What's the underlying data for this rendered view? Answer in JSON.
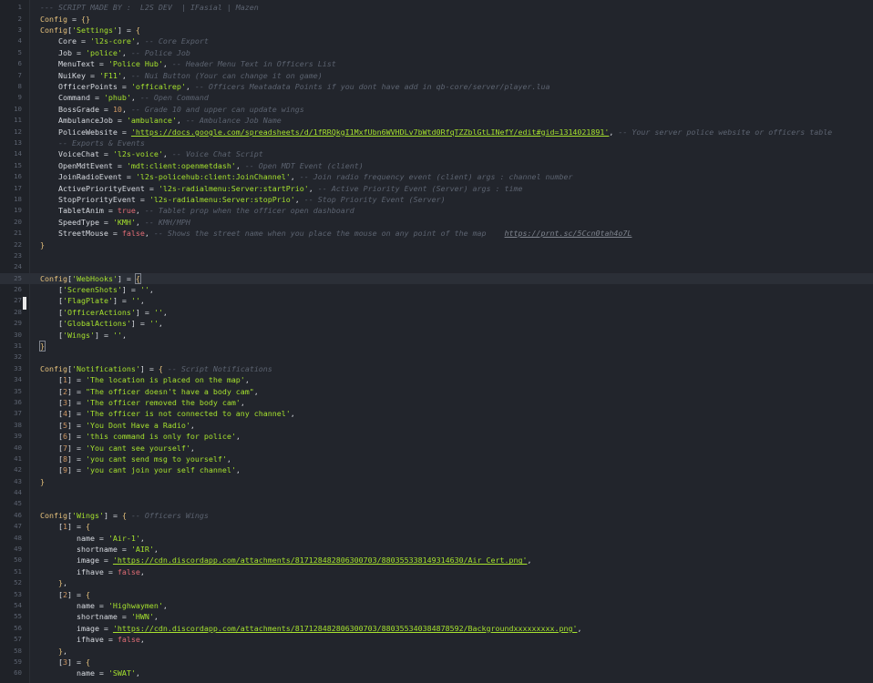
{
  "editor": {
    "active_line": 25,
    "lines": [
      {
        "n": "1",
        "tokens": [
          [
            "cmt",
            "--- SCRIPT MADE BY :  L2S DEV  | IFasial | Mazen"
          ]
        ]
      },
      {
        "n": "2",
        "tokens": [
          [
            "kw",
            "Config"
          ],
          [
            "plain",
            " = "
          ],
          [
            "brace",
            "{}"
          ]
        ]
      },
      {
        "n": "3",
        "tokens": [
          [
            "kw",
            "Config"
          ],
          [
            "plain",
            "["
          ],
          [
            "str",
            "'Settings'"
          ],
          [
            "plain",
            "] = "
          ],
          [
            "brace",
            "{"
          ]
        ]
      },
      {
        "n": "4",
        "tokens": [
          [
            "plain",
            "    Core = "
          ],
          [
            "str",
            "'l2s-core'"
          ],
          [
            "plain",
            ", "
          ],
          [
            "cmt",
            "-- Core Export"
          ]
        ]
      },
      {
        "n": "5",
        "tokens": [
          [
            "plain",
            "    Job = "
          ],
          [
            "str",
            "'police'"
          ],
          [
            "plain",
            ", "
          ],
          [
            "cmt",
            "-- Police Job"
          ]
        ]
      },
      {
        "n": "6",
        "tokens": [
          [
            "plain",
            "    MenuText = "
          ],
          [
            "str",
            "'Police Hub'"
          ],
          [
            "plain",
            ", "
          ],
          [
            "cmt",
            "-- Header Menu Text in Officers List"
          ]
        ]
      },
      {
        "n": "7",
        "tokens": [
          [
            "plain",
            "    NuiKey = "
          ],
          [
            "str",
            "'F11'"
          ],
          [
            "plain",
            ", "
          ],
          [
            "cmt",
            "-- Nui Button (Your can change it on game)"
          ]
        ]
      },
      {
        "n": "8",
        "tokens": [
          [
            "plain",
            "    OfficerPoints = "
          ],
          [
            "str",
            "'officalrep'"
          ],
          [
            "plain",
            ", "
          ],
          [
            "cmt",
            "-- Officers Meatadata Points if you dont have add in qb-core/server/player.lua"
          ]
        ]
      },
      {
        "n": "9",
        "tokens": [
          [
            "plain",
            "    Command = "
          ],
          [
            "str",
            "'phub'"
          ],
          [
            "plain",
            ", "
          ],
          [
            "cmt",
            "-- Open Command"
          ]
        ]
      },
      {
        "n": "10",
        "tokens": [
          [
            "plain",
            "    BossGrade = "
          ],
          [
            "num",
            "10"
          ],
          [
            "plain",
            ", "
          ],
          [
            "cmt",
            "-- Grade 10 and upper can update wings"
          ]
        ]
      },
      {
        "n": "11",
        "tokens": [
          [
            "plain",
            "    AmbulanceJob = "
          ],
          [
            "str",
            "'ambulance'"
          ],
          [
            "plain",
            ", "
          ],
          [
            "cmt",
            "-- Ambulance Job Name"
          ]
        ]
      },
      {
        "n": "12",
        "tokens": [
          [
            "plain",
            "    PoliceWebsite = "
          ],
          [
            "url",
            "'https://docs.google.com/spreadsheets/d/1fRRQkgI1MxfUbn6WVHDLv7bWtd0RfqTZZblGtLINefY/edit#gid=1314021891'"
          ],
          [
            "plain",
            ", "
          ],
          [
            "cmt",
            "-- Your server police website or officers table"
          ]
        ]
      },
      {
        "n": "13",
        "tokens": [
          [
            "cmt",
            "    -- Exports & Events"
          ]
        ]
      },
      {
        "n": "14",
        "tokens": [
          [
            "plain",
            "    VoiceChat = "
          ],
          [
            "str",
            "'l2s-voice'"
          ],
          [
            "plain",
            ", "
          ],
          [
            "cmt",
            "-- Voice Chat Script"
          ]
        ]
      },
      {
        "n": "15",
        "tokens": [
          [
            "plain",
            "    OpenMdtEvent = "
          ],
          [
            "str",
            "'mdt:client:openmetdash'"
          ],
          [
            "plain",
            ", "
          ],
          [
            "cmt",
            "-- Open MDT Event (client)"
          ]
        ]
      },
      {
        "n": "16",
        "tokens": [
          [
            "plain",
            "    JoinRadioEvent = "
          ],
          [
            "str",
            "'l2s-policehub:client:JoinChannel'"
          ],
          [
            "plain",
            ", "
          ],
          [
            "cmt",
            "-- Join radio frequency event (client) args : channel number"
          ]
        ]
      },
      {
        "n": "17",
        "tokens": [
          [
            "plain",
            "    ActivePriorityEvent = "
          ],
          [
            "str",
            "'l2s-radialmenu:Server:startPrio'"
          ],
          [
            "plain",
            ", "
          ],
          [
            "cmt",
            "-- Active Priority Event (Server) args : time"
          ]
        ]
      },
      {
        "n": "18",
        "tokens": [
          [
            "plain",
            "    StopPriorityEvent = "
          ],
          [
            "str",
            "'l2s-radialmenu:Server:stopPrio'"
          ],
          [
            "plain",
            ", "
          ],
          [
            "cmt",
            "-- Stop Priority Event (Server)"
          ]
        ]
      },
      {
        "n": "19",
        "tokens": [
          [
            "plain",
            "    TabletAnim = "
          ],
          [
            "bool",
            "true"
          ],
          [
            "plain",
            ", "
          ],
          [
            "cmt",
            "-- Tablet prop when the officer open dashboard"
          ]
        ]
      },
      {
        "n": "20",
        "tokens": [
          [
            "plain",
            "    SpeedType = "
          ],
          [
            "str",
            "'KMH'"
          ],
          [
            "plain",
            ", "
          ],
          [
            "cmt",
            "-- KMH/MPH"
          ]
        ]
      },
      {
        "n": "21",
        "tokens": [
          [
            "plain",
            "    StreetMouse = "
          ],
          [
            "bool",
            "false"
          ],
          [
            "plain",
            ", "
          ],
          [
            "cmt",
            "-- Shows the street name when you place the mouse on any point of the map    "
          ],
          [
            "link",
            "https://prnt.sc/5Ccn0tah4o7L"
          ]
        ]
      },
      {
        "n": "22",
        "tokens": [
          [
            "brace",
            "}"
          ]
        ]
      },
      {
        "n": "23",
        "tokens": []
      },
      {
        "n": "24",
        "tokens": []
      },
      {
        "n": "25",
        "tokens": [
          [
            "kw",
            "Config"
          ],
          [
            "plain",
            "["
          ],
          [
            "str",
            "'WebHooks'"
          ],
          [
            "plain",
            "] = "
          ],
          [
            "bracehl",
            "{"
          ]
        ]
      },
      {
        "n": "26",
        "tokens": [
          [
            "plain",
            "    ["
          ],
          [
            "str",
            "'ScreenShots'"
          ],
          [
            "plain",
            "] = "
          ],
          [
            "str",
            "''"
          ],
          [
            "plain",
            ","
          ]
        ]
      },
      {
        "n": "27",
        "tokens": [
          [
            "plain",
            "    ["
          ],
          [
            "str",
            "'FlagPlate'"
          ],
          [
            "plain",
            "] = "
          ],
          [
            "str",
            "''"
          ],
          [
            "plain",
            ","
          ]
        ]
      },
      {
        "n": "28",
        "tokens": [
          [
            "plain",
            "    ["
          ],
          [
            "str",
            "'OfficerActions'"
          ],
          [
            "plain",
            "] = "
          ],
          [
            "str",
            "''"
          ],
          [
            "plain",
            ","
          ]
        ]
      },
      {
        "n": "29",
        "tokens": [
          [
            "plain",
            "    ["
          ],
          [
            "str",
            "'GlobalActions'"
          ],
          [
            "plain",
            "] = "
          ],
          [
            "str",
            "''"
          ],
          [
            "plain",
            ","
          ]
        ]
      },
      {
        "n": "30",
        "tokens": [
          [
            "plain",
            "    ["
          ],
          [
            "str",
            "'Wings'"
          ],
          [
            "plain",
            "] = "
          ],
          [
            "str",
            "''"
          ],
          [
            "plain",
            ","
          ]
        ]
      },
      {
        "n": "31",
        "tokens": [
          [
            "bracehl",
            "}"
          ]
        ]
      },
      {
        "n": "32",
        "tokens": []
      },
      {
        "n": "33",
        "tokens": [
          [
            "kw",
            "Config"
          ],
          [
            "plain",
            "["
          ],
          [
            "str",
            "'Notifications'"
          ],
          [
            "plain",
            "] = "
          ],
          [
            "brace",
            "{"
          ],
          [
            "plain",
            " "
          ],
          [
            "cmt",
            "-- Script Notifications"
          ]
        ]
      },
      {
        "n": "34",
        "tokens": [
          [
            "plain",
            "    ["
          ],
          [
            "num",
            "1"
          ],
          [
            "plain",
            "] = "
          ],
          [
            "str",
            "'The location is placed on the map'"
          ],
          [
            "plain",
            ","
          ]
        ]
      },
      {
        "n": "35",
        "tokens": [
          [
            "plain",
            "    ["
          ],
          [
            "num",
            "2"
          ],
          [
            "plain",
            "] = "
          ],
          [
            "str",
            "\"The officer doesn't have a body cam\""
          ],
          [
            "plain",
            ","
          ]
        ]
      },
      {
        "n": "36",
        "tokens": [
          [
            "plain",
            "    ["
          ],
          [
            "num",
            "3"
          ],
          [
            "plain",
            "] = "
          ],
          [
            "str",
            "'The officer removed the body cam'"
          ],
          [
            "plain",
            ","
          ]
        ]
      },
      {
        "n": "37",
        "tokens": [
          [
            "plain",
            "    ["
          ],
          [
            "num",
            "4"
          ],
          [
            "plain",
            "] = "
          ],
          [
            "str",
            "'The officer is not connected to any channel'"
          ],
          [
            "plain",
            ","
          ]
        ]
      },
      {
        "n": "38",
        "tokens": [
          [
            "plain",
            "    ["
          ],
          [
            "num",
            "5"
          ],
          [
            "plain",
            "] = "
          ],
          [
            "str",
            "'You Dont Have a Radio'"
          ],
          [
            "plain",
            ","
          ]
        ]
      },
      {
        "n": "39",
        "tokens": [
          [
            "plain",
            "    ["
          ],
          [
            "num",
            "6"
          ],
          [
            "plain",
            "] = "
          ],
          [
            "str",
            "'this command is only for police'"
          ],
          [
            "plain",
            ","
          ]
        ]
      },
      {
        "n": "40",
        "tokens": [
          [
            "plain",
            "    ["
          ],
          [
            "num",
            "7"
          ],
          [
            "plain",
            "] = "
          ],
          [
            "str",
            "'You cant see yourself'"
          ],
          [
            "plain",
            ","
          ]
        ]
      },
      {
        "n": "41",
        "tokens": [
          [
            "plain",
            "    ["
          ],
          [
            "num",
            "8"
          ],
          [
            "plain",
            "] = "
          ],
          [
            "str",
            "'you cant send msg to yourself'"
          ],
          [
            "plain",
            ","
          ]
        ]
      },
      {
        "n": "42",
        "tokens": [
          [
            "plain",
            "    ["
          ],
          [
            "num",
            "9"
          ],
          [
            "plain",
            "] = "
          ],
          [
            "str",
            "'you cant join your self channel'"
          ],
          [
            "plain",
            ","
          ]
        ]
      },
      {
        "n": "43",
        "tokens": [
          [
            "brace",
            "}"
          ]
        ]
      },
      {
        "n": "44",
        "tokens": []
      },
      {
        "n": "45",
        "tokens": []
      },
      {
        "n": "46",
        "tokens": [
          [
            "kw",
            "Config"
          ],
          [
            "plain",
            "["
          ],
          [
            "str",
            "'Wings'"
          ],
          [
            "plain",
            "] = "
          ],
          [
            "brace",
            "{"
          ],
          [
            "plain",
            " "
          ],
          [
            "cmt",
            "-- Officers Wings"
          ]
        ]
      },
      {
        "n": "47",
        "tokens": [
          [
            "plain",
            "    ["
          ],
          [
            "num",
            "1"
          ],
          [
            "plain",
            "] = "
          ],
          [
            "brace",
            "{"
          ]
        ]
      },
      {
        "n": "48",
        "tokens": [
          [
            "plain",
            "        name = "
          ],
          [
            "str",
            "'Air-1'"
          ],
          [
            "plain",
            ","
          ]
        ]
      },
      {
        "n": "49",
        "tokens": [
          [
            "plain",
            "        shortname = "
          ],
          [
            "str",
            "'AIR'"
          ],
          [
            "plain",
            ","
          ]
        ]
      },
      {
        "n": "50",
        "tokens": [
          [
            "plain",
            "        image = "
          ],
          [
            "url",
            "'https://cdn.discordapp.com/attachments/817128482806300703/880355338149314630/Air_Cert.png'"
          ],
          [
            "plain",
            ","
          ]
        ]
      },
      {
        "n": "51",
        "tokens": [
          [
            "plain",
            "        ifhave = "
          ],
          [
            "bool",
            "false"
          ],
          [
            "plain",
            ","
          ]
        ]
      },
      {
        "n": "52",
        "tokens": [
          [
            "plain",
            "    "
          ],
          [
            "brace",
            "}"
          ],
          [
            "plain",
            ","
          ]
        ]
      },
      {
        "n": "53",
        "tokens": [
          [
            "plain",
            "    ["
          ],
          [
            "num",
            "2"
          ],
          [
            "plain",
            "] = "
          ],
          [
            "brace",
            "{"
          ]
        ]
      },
      {
        "n": "54",
        "tokens": [
          [
            "plain",
            "        name = "
          ],
          [
            "str",
            "'Highwaymen'"
          ],
          [
            "plain",
            ","
          ]
        ]
      },
      {
        "n": "55",
        "tokens": [
          [
            "plain",
            "        shortname = "
          ],
          [
            "str",
            "'HWN'"
          ],
          [
            "plain",
            ","
          ]
        ]
      },
      {
        "n": "56",
        "tokens": [
          [
            "plain",
            "        image = "
          ],
          [
            "url",
            "'https://cdn.discordapp.com/attachments/817128482806300703/880355340384878592/Backgroundxxxxxxxxx.png'"
          ],
          [
            "plain",
            ","
          ]
        ]
      },
      {
        "n": "57",
        "tokens": [
          [
            "plain",
            "        ifhave = "
          ],
          [
            "bool",
            "false"
          ],
          [
            "plain",
            ","
          ]
        ]
      },
      {
        "n": "58",
        "tokens": [
          [
            "plain",
            "    "
          ],
          [
            "brace",
            "}"
          ],
          [
            "plain",
            ","
          ]
        ]
      },
      {
        "n": "59",
        "tokens": [
          [
            "plain",
            "    ["
          ],
          [
            "num",
            "3"
          ],
          [
            "plain",
            "] = "
          ],
          [
            "brace",
            "{"
          ]
        ]
      },
      {
        "n": "60",
        "tokens": [
          [
            "plain",
            "        name = "
          ],
          [
            "str",
            "'SWAT'"
          ],
          [
            "plain",
            ","
          ]
        ]
      }
    ]
  }
}
